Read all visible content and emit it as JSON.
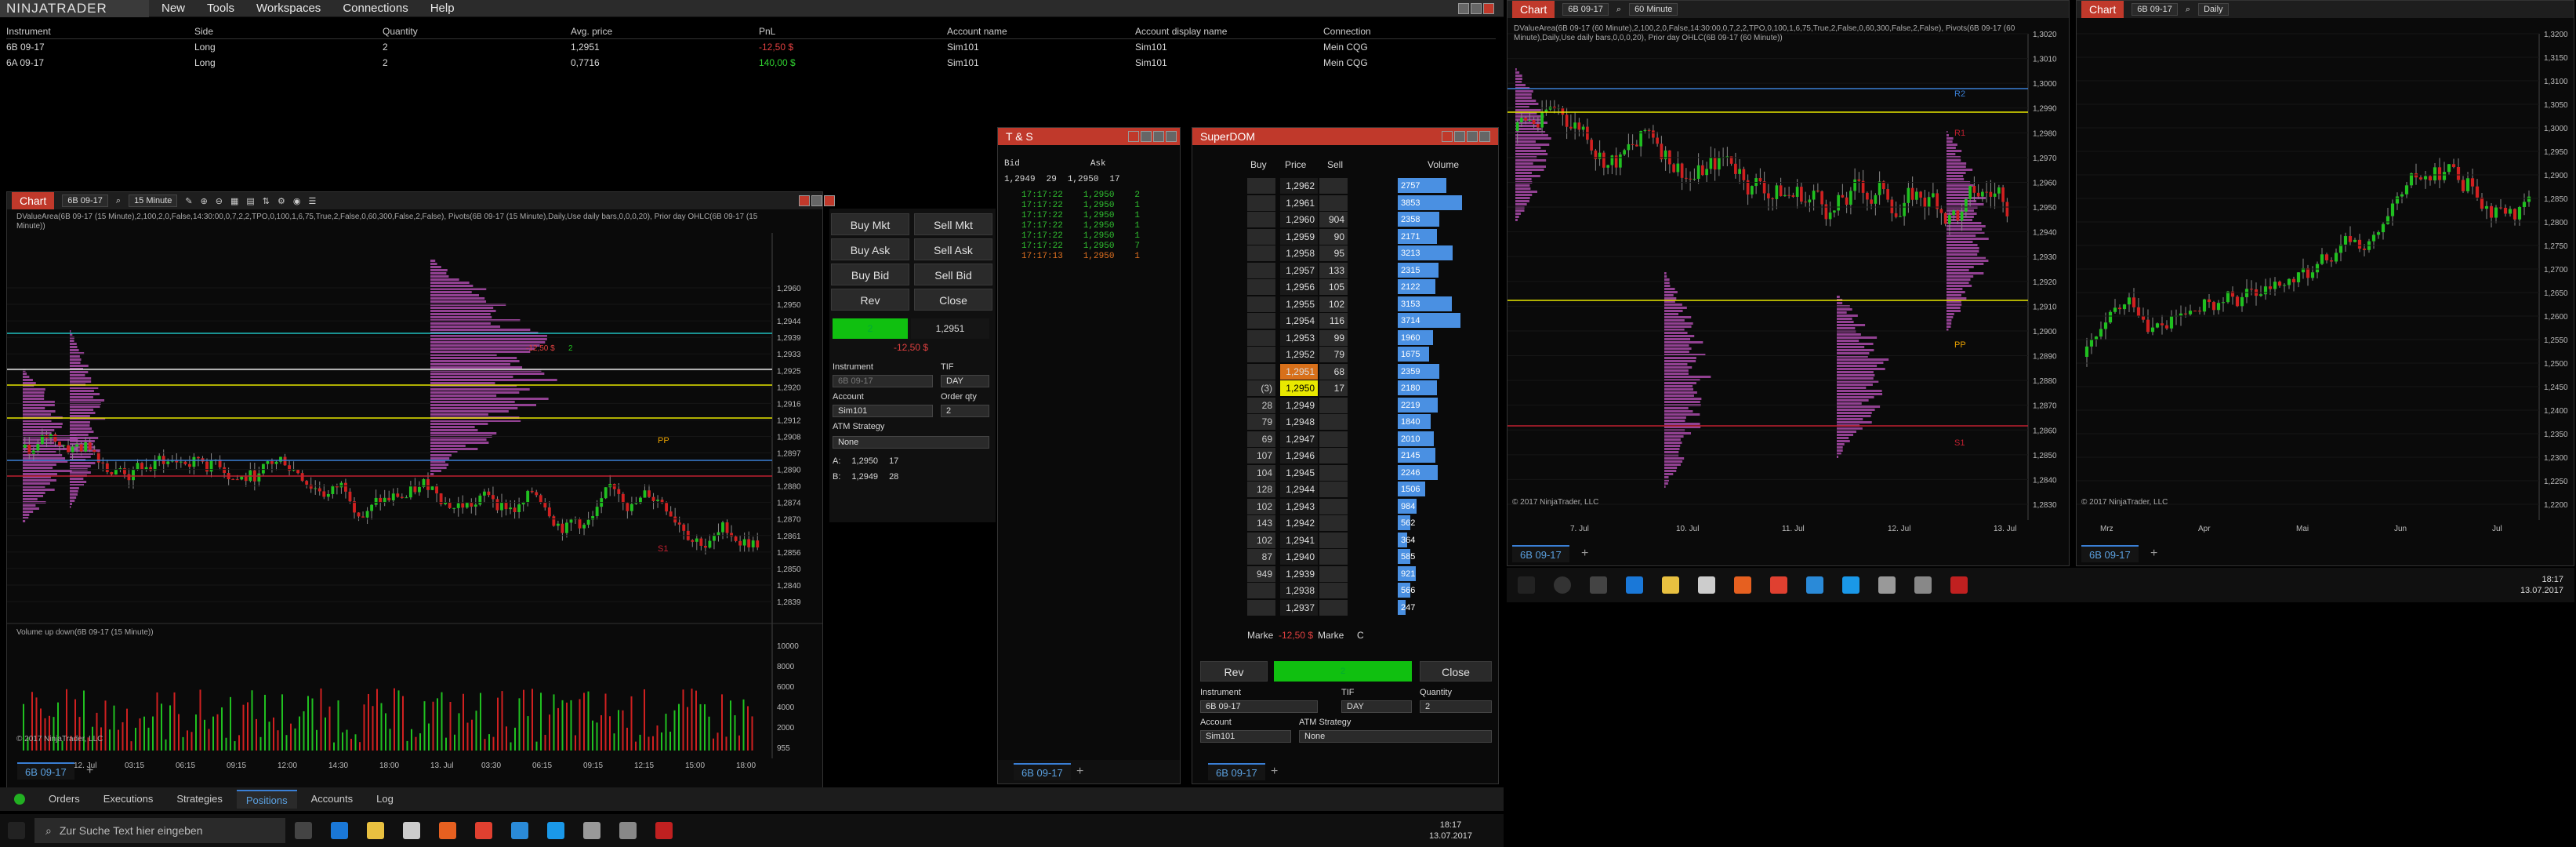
{
  "app": {
    "logo": "NINJATRADER",
    "menu": [
      "New",
      "Tools",
      "Workspaces",
      "Connections",
      "Help"
    ]
  },
  "positions": {
    "headers": [
      "Instrument",
      "Side",
      "Quantity",
      "Avg. price",
      "PnL",
      "Account name",
      "Account display name",
      "Connection"
    ],
    "rows": [
      [
        "6B 09-17",
        "Long",
        "2",
        "1,2951",
        "-12,50 $",
        "Sim101",
        "Sim101",
        "Mein CQG"
      ],
      [
        "6A 09-17",
        "Long",
        "2",
        "0,7716",
        "140,00 $",
        "Sim101",
        "Sim101",
        "Mein CQG"
      ]
    ]
  },
  "chart1": {
    "title": "Chart",
    "instrument": "6B 09-17",
    "interval": "15 Minute",
    "indicator_text": "DValueArea(6B 09-17 (15 Minute),2,100,2,0,False,14:30:00,0,7,2,2,TPO,0,100,1,6,75,True,2,False,0,60,300,False,2,False), Pivots(6B 09-17 (15 Minute),Daily,Use daily bars,0,0,0,20), Prior day OHLC(6B 09-17 (15 Minute))",
    "prices": [
      "1,2960",
      "1,2950",
      "1,2944",
      "1,2939",
      "1,2933",
      "1,2925",
      "1,2920",
      "1,2916",
      "1,2912",
      "1,2908",
      "1,2897",
      "1,2890",
      "1,2880",
      "1,2874",
      "1,2870",
      "1,2861",
      "1,2856",
      "1,2850",
      "1,2840",
      "1,2839"
    ],
    "time_labels": [
      "18:45",
      "12. Jul",
      "03:15",
      "06:15",
      "09:15",
      "12:00",
      "14:30",
      "18:00",
      "13. Jul",
      "03:30",
      "06:15",
      "09:15",
      "12:15",
      "15:00",
      "18:00"
    ],
    "pivot_labels": [
      "PP",
      "S1"
    ],
    "copyright": "© 2017 NinjaTrader, LLC",
    "volume_title": "Volume up down(6B 09-17 (15 Minute))",
    "volume_axis": [
      "10000",
      "8000",
      "6000",
      "4000",
      "2000",
      "955"
    ],
    "pnl_label": "-12,50 $",
    "qty_badge": "2",
    "tab": "6B 09-17"
  },
  "order": {
    "buy_mkt": "Buy Mkt",
    "sell_mkt": "Sell Mkt",
    "buy_ask": "Buy Ask",
    "sell_ask": "Sell Ask",
    "buy_bid": "Buy Bid",
    "sell_bid": "Sell Bid",
    "rev": "Rev",
    "close": "Close",
    "pos_qty": "2",
    "pos_price": "1,2951",
    "pnl": "-12,50 $",
    "instrument_label": "Instrument",
    "instrument": "6B 09-17",
    "tif_label": "TIF",
    "tif": "DAY",
    "account_label": "Account",
    "account": "Sim101",
    "qty_label": "Order qty",
    "qty": "2",
    "atm_label": "ATM Strategy",
    "atm": "None",
    "ask_line": [
      "A:",
      "1,2950",
      "17"
    ],
    "bid_line": [
      "B:",
      "1,2949",
      "28"
    ]
  },
  "ts": {
    "title": "T & S",
    "bid_label": "Bid",
    "ask_label": "Ask",
    "bid": "1,2949",
    "bid_size": "29",
    "ask": "1,2950",
    "ask_size": "17",
    "rows": [
      [
        "17:17:22",
        "1,2950",
        "2"
      ],
      [
        "17:17:22",
        "1,2950",
        "1"
      ],
      [
        "17:17:22",
        "1,2950",
        "1"
      ],
      [
        "17:17:22",
        "1,2950",
        "1"
      ],
      [
        "17:17:22",
        "1,2950",
        "1"
      ],
      [
        "17:17:22",
        "1,2950",
        "7"
      ],
      [
        "17:17:13",
        "1,2950",
        "1"
      ]
    ],
    "tab": "6B 09-17"
  },
  "dom": {
    "title": "SuperDOM",
    "headers": [
      "Buy",
      "Price",
      "Sell",
      "Volume"
    ],
    "rows": [
      [
        "",
        "1,2962",
        "",
        "2757"
      ],
      [
        "",
        "1,2961",
        "",
        "3853"
      ],
      [
        "",
        "1,2960",
        "904",
        "2358"
      ],
      [
        "",
        "1,2959",
        "90",
        "2171"
      ],
      [
        "",
        "1,2958",
        "95",
        "3213"
      ],
      [
        "",
        "1,2957",
        "133",
        "2315"
      ],
      [
        "",
        "1,2956",
        "105",
        "2122"
      ],
      [
        "",
        "1,2955",
        "102",
        "3153"
      ],
      [
        "",
        "1,2954",
        "116",
        "3714"
      ],
      [
        "",
        "1,2953",
        "99",
        "1960"
      ],
      [
        "",
        "1,2952",
        "79",
        "1675"
      ],
      [
        "",
        "1,2951",
        "68",
        "2359"
      ],
      [
        "(3)",
        "1,2950",
        "17",
        "2180"
      ],
      [
        "28",
        "1,2949",
        "",
        "2219"
      ],
      [
        "79",
        "1,2948",
        "",
        "1840"
      ],
      [
        "69",
        "1,2947",
        "",
        "2010"
      ],
      [
        "107",
        "1,2946",
        "",
        "2145"
      ],
      [
        "104",
        "1,2945",
        "",
        "2246"
      ],
      [
        "128",
        "1,2944",
        "",
        "1506"
      ],
      [
        "102",
        "1,2943",
        "",
        "984"
      ],
      [
        "143",
        "1,2942",
        "",
        "562"
      ],
      [
        "102",
        "1,2941",
        "",
        "364"
      ],
      [
        "87",
        "1,2940",
        "",
        "585"
      ],
      [
        "949",
        "1,2939",
        "",
        "921"
      ],
      [
        "",
        "1,2938",
        "",
        "566"
      ],
      [
        "",
        "1,2937",
        "",
        "247"
      ]
    ],
    "volume_fill": [
      0.48,
      0.65,
      0.41,
      0.38,
      0.55,
      0.4,
      0.37,
      0.54,
      0.63,
      0.34,
      0.3,
      0.41,
      0.38,
      0.39,
      0.32,
      0.35,
      0.37,
      0.39,
      0.26,
      0.17,
      0.1,
      0.07,
      0.1,
      0.16,
      0.1,
      0.05
    ],
    "marker_left": "Marke",
    "pnl": "-12,50 $",
    "marker_right": "Marke",
    "c": "C",
    "rev": "Rev",
    "qty": "2",
    "close": "Close",
    "instrument_label": "Instrument",
    "instrument": "6B 09-17",
    "tif_label": "TIF",
    "tif": "DAY",
    "qty_label": "Quantity",
    "qty_val": "2",
    "account_label": "Account",
    "account": "Sim101",
    "atm_label": "ATM Strategy",
    "atm": "None",
    "tab": "6B 09-17"
  },
  "chart2": {
    "title": "Chart",
    "instrument": "6B 09-17",
    "interval": "60 Minute",
    "indicator_text": "DValueArea(6B 09-17 (60 Minute),2,100,2,0,False,14:30:00,0,7,2,2,TPO,0,100,1,6,75,True,2,False,0,60,300,False,2,False), Pivots(6B 09-17 (60 Minute),Daily,Use daily bars,0,0,0,20), Prior day OHLC(6B 09-17 (60 Minute))",
    "prices": [
      "1,3020",
      "1,3010",
      "1,3000",
      "1,2990",
      "1,2980",
      "1,2970",
      "1,2960",
      "1,2950",
      "1,2940",
      "1,2930",
      "1,2920",
      "1,2910",
      "1,2900",
      "1,2890",
      "1,2880",
      "1,2870",
      "1,2860",
      "1,2850",
      "1,2840",
      "1,2830"
    ],
    "dates": [
      "7. Jul",
      "10. Jul",
      "11. Jul",
      "12. Jul",
      "13. Jul"
    ],
    "pivot_labels": [
      "R2",
      "R1",
      "PP",
      "S1"
    ],
    "copyright": "© 2017 NinjaTrader, LLC",
    "tab": "6B 09-17"
  },
  "chart3": {
    "title": "Chart",
    "instrument": "6B 09-17",
    "interval": "Daily",
    "prices": [
      "1,3200",
      "1,3150",
      "1,3100",
      "1,3050",
      "1,3000",
      "1,2950",
      "1,2900",
      "1,2850",
      "1,2800",
      "1,2750",
      "1,2700",
      "1,2650",
      "1,2600",
      "1,2550",
      "1,2500",
      "1,2450",
      "1,2400",
      "1,2350",
      "1,2300",
      "1,2250",
      "1,2200"
    ],
    "dates": [
      "Mrz",
      "Apr",
      "Mai",
      "Jun",
      "Jul"
    ],
    "copyright": "© 2017 NinjaTrader, LLC",
    "tab": "6B 09-17"
  },
  "bottom_tabs": [
    "Orders",
    "Executions",
    "Strategies",
    "Positions",
    "Accounts",
    "Log"
  ],
  "taskbar": {
    "search": "Zur Suche Text hier eingeben",
    "time": "18:17",
    "date": "13.07.2017"
  },
  "taskbar2": {
    "time": "18:17",
    "date": "13.07.2017"
  },
  "colors": {
    "accent_red": "#c0392b",
    "green": "#10c010",
    "magenta": "#b44fb4",
    "blue": "#3a7fd5",
    "yellow": "#e8e800"
  }
}
